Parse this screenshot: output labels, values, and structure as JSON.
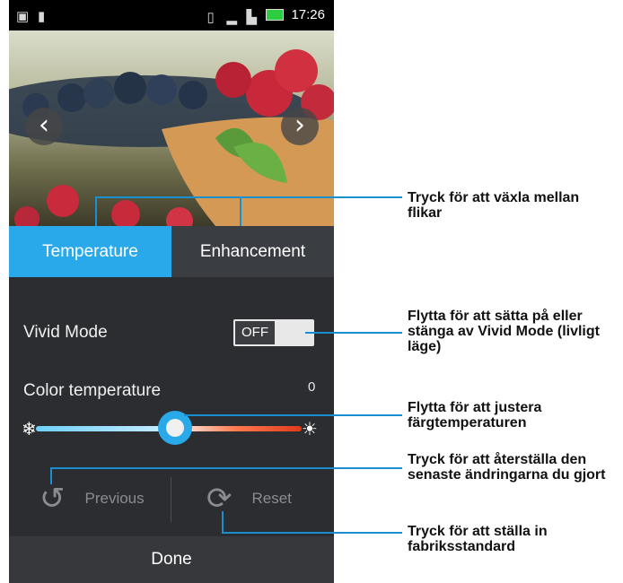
{
  "status_bar": {
    "time": "17:26"
  },
  "photo": {
    "prev_icon": "chevron-left-icon",
    "next_icon": "chevron-right-icon"
  },
  "tabs": [
    {
      "label": "Temperature",
      "active": true
    },
    {
      "label": "Enhancement",
      "active": false
    }
  ],
  "vivid_mode": {
    "label": "Vivid Mode",
    "toggle_state": "OFF"
  },
  "color_temperature": {
    "label": "Color temperature",
    "value": "0",
    "slider_position": 0.5
  },
  "actions": {
    "previous_label": "Previous",
    "reset_label": "Reset"
  },
  "done_label": "Done",
  "callouts": {
    "tabs": "Tryck för att växla mellan flikar",
    "vivid": "Flytta för att sätta  på eller stänga av Vivid Mode (livligt läge)",
    "slider": "Flytta för att justera färgtemperaturen",
    "previous": "Tryck för att återställa den senaste ändringarna du gjort",
    "reset": "Tryck för att ställa in fabriksstandard"
  },
  "colors": {
    "accent": "#2aa9ea",
    "panel": "#2b2d30",
    "callout_line": "#1a8fd0"
  }
}
